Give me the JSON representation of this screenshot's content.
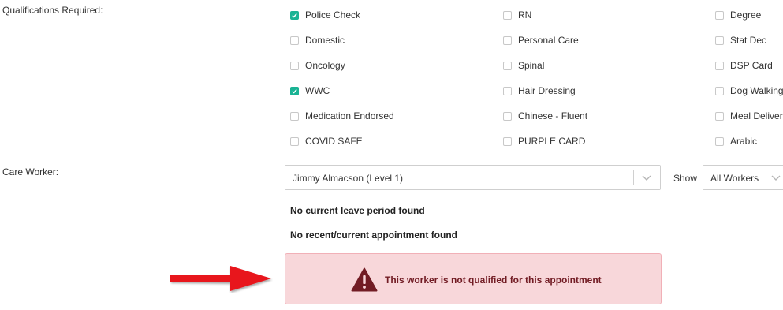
{
  "qualifications": {
    "label": "Qualifications Required:",
    "items": [
      {
        "label": "Police Check",
        "checked": true
      },
      {
        "label": "RN",
        "checked": false
      },
      {
        "label": "Degree",
        "checked": false
      },
      {
        "label": "Domestic",
        "checked": false
      },
      {
        "label": "Personal Care",
        "checked": false
      },
      {
        "label": "Stat Dec",
        "checked": false
      },
      {
        "label": "Oncology",
        "checked": false
      },
      {
        "label": "Spinal",
        "checked": false
      },
      {
        "label": "DSP Card",
        "checked": false
      },
      {
        "label": "WWC",
        "checked": true
      },
      {
        "label": "Hair Dressing",
        "checked": false
      },
      {
        "label": "Dog Walking",
        "checked": false
      },
      {
        "label": "Medication Endorsed",
        "checked": false
      },
      {
        "label": "Chinese - Fluent",
        "checked": false
      },
      {
        "label": "Meal Delivery",
        "checked": false
      },
      {
        "label": "COVID SAFE",
        "checked": false
      },
      {
        "label": "PURPLE CARD",
        "checked": false
      },
      {
        "label": "Arabic",
        "checked": false
      }
    ]
  },
  "care_worker": {
    "label": "Care Worker:",
    "selected": "Jimmy Almacson (Level 1)",
    "show_label": "Show",
    "show_selected": "All Workers"
  },
  "status": {
    "leave": "No current leave period found",
    "appointment": "No recent/current appointment found"
  },
  "alert": {
    "message": "This worker is not qualified for this appointment",
    "icon": "warning-triangle-icon",
    "color": "#721c24",
    "background": "#f8d7da"
  },
  "colors": {
    "checkbox_checked": "#1ab394",
    "arrow": "#e8141b"
  }
}
